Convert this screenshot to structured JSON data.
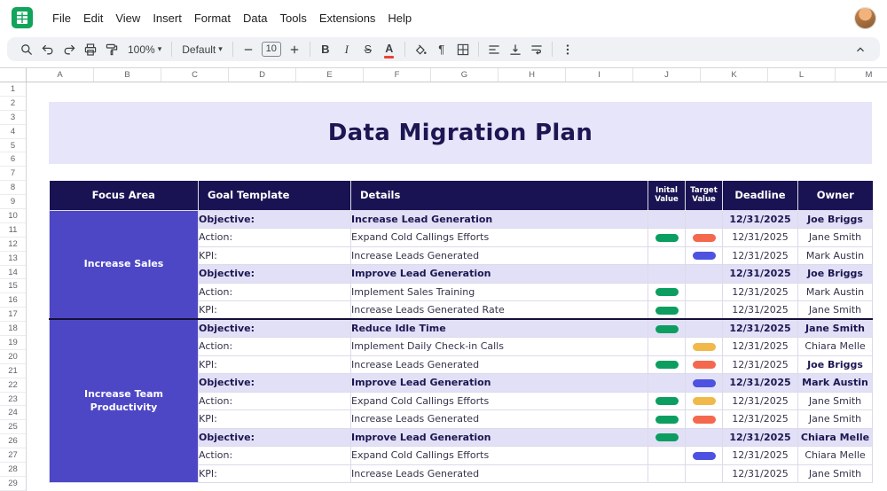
{
  "menu_bar": {
    "items": [
      "File",
      "Edit",
      "View",
      "Insert",
      "Format",
      "Data",
      "Tools",
      "Extensions",
      "Help"
    ]
  },
  "toolbar": {
    "zoom_label": "100%",
    "font_label": "Default",
    "font_size": "10"
  },
  "grid": {
    "columns": [
      "A",
      "B",
      "C",
      "D",
      "E",
      "F",
      "G",
      "H",
      "I",
      "J",
      "K",
      "L",
      "M"
    ],
    "rows": [
      "1",
      "2",
      "3",
      "4",
      "5",
      "6",
      "7",
      "8",
      "9",
      "10",
      "11",
      "12",
      "13",
      "14",
      "15",
      "16",
      "17",
      "18",
      "19",
      "20",
      "21",
      "22",
      "23",
      "24",
      "25",
      "26",
      "27",
      "28",
      "29"
    ]
  },
  "sheet": {
    "title": "Data Migration Plan",
    "table": {
      "headers": [
        "Focus Area",
        "Goal Template",
        "Details",
        "Inital\nValue",
        "Target\nValue",
        "Deadline",
        "Owner"
      ],
      "groups": [
        {
          "focus_area": "Increase Sales",
          "rows": [
            {
              "type": "objective",
              "label": "Objective:",
              "details": "Increase Lead Generation",
              "initial": null,
              "target": null,
              "deadline": "12/31/2025",
              "owner": "Joe Briggs"
            },
            {
              "type": "action",
              "label": "Action:",
              "details": "Expand Cold Callings Efforts",
              "initial": "green",
              "target": "orange",
              "deadline": "12/31/2025",
              "owner": "Jane Smith"
            },
            {
              "type": "kpi",
              "label": "KPI:",
              "details": "Increase Leads Generated",
              "initial": null,
              "target": "blue",
              "deadline": "12/31/2025",
              "owner": "Mark Austin"
            },
            {
              "type": "objective",
              "label": "Objective:",
              "details": "Improve Lead Generation",
              "initial": null,
              "target": null,
              "deadline": "12/31/2025",
              "owner": "Joe Briggs"
            },
            {
              "type": "action",
              "label": "Action:",
              "details": "Implement Sales Training",
              "initial": "green",
              "target": null,
              "deadline": "12/31/2025",
              "owner": "Mark Austin"
            },
            {
              "type": "kpi",
              "label": "KPI:",
              "details": "Increase Leads Generated Rate",
              "initial": "green",
              "target": null,
              "deadline": "12/31/2025",
              "owner": "Jane Smith"
            }
          ]
        },
        {
          "focus_area": "Increase Team Productivity",
          "rows": [
            {
              "type": "objective",
              "label": "Objective:",
              "details": "Reduce Idle Time",
              "initial": "green",
              "target": null,
              "deadline": "12/31/2025",
              "owner": "Jane Smith"
            },
            {
              "type": "action",
              "label": "Action:",
              "details": "Implement Daily Check-in Calls",
              "initial": null,
              "target": "yellow",
              "deadline": "12/31/2025",
              "owner": "Chiara Melle"
            },
            {
              "type": "kpi",
              "label": "KPI:",
              "details": "Increase Leads Generated",
              "initial": "green",
              "target": "orange",
              "deadline": "12/31/2025",
              "owner": "Joe Briggs",
              "owner_bold": true
            },
            {
              "type": "objective",
              "label": "Objective:",
              "details": "Improve Lead Generation",
              "initial": null,
              "target": "blue",
              "deadline": "12/31/2025",
              "owner": "Mark Austin"
            },
            {
              "type": "action",
              "label": "Action:",
              "details": "Expand Cold Callings Efforts",
              "initial": "green",
              "target": "yellow",
              "deadline": "12/31/2025",
              "owner": "Jane Smith"
            },
            {
              "type": "kpi",
              "label": "KPI:",
              "details": "Increase Leads Generated",
              "initial": "green",
              "target": "orange",
              "deadline": "12/31/2025",
              "owner": "Jane Smith"
            },
            {
              "type": "objective",
              "label": "Objective:",
              "details": "Improve Lead Generation",
              "initial": "green",
              "target": null,
              "deadline": "12/31/2025",
              "owner": "Chiara Melle"
            },
            {
              "type": "action",
              "label": "Action:",
              "details": "Expand Cold Callings Efforts",
              "initial": null,
              "target": "blue",
              "deadline": "12/31/2025",
              "owner": "Chiara Melle"
            },
            {
              "type": "kpi",
              "label": "KPI:",
              "details": "Increase Leads Generated",
              "initial": null,
              "target": null,
              "deadline": "12/31/2025",
              "owner": "Jane Smith"
            }
          ]
        }
      ]
    }
  },
  "colors": {
    "theme": {
      "header_bg": "#191353",
      "focus_bg": "#4d47c6",
      "highlight": "#e2e0f6",
      "banner_bg": "#e7e5fa",
      "toolbar_bg": "#f0f1f5",
      "text_dark": "#1c1752",
      "text_body": "#34344a",
      "cell_border": "#dcdaeb",
      "divider": "#141038",
      "logo_green": "#12a45c"
    },
    "pills": {
      "green": "#0b9e60",
      "orange": "#f4694e",
      "yellow": "#f1b94a",
      "blue": "#4d53e0"
    }
  }
}
